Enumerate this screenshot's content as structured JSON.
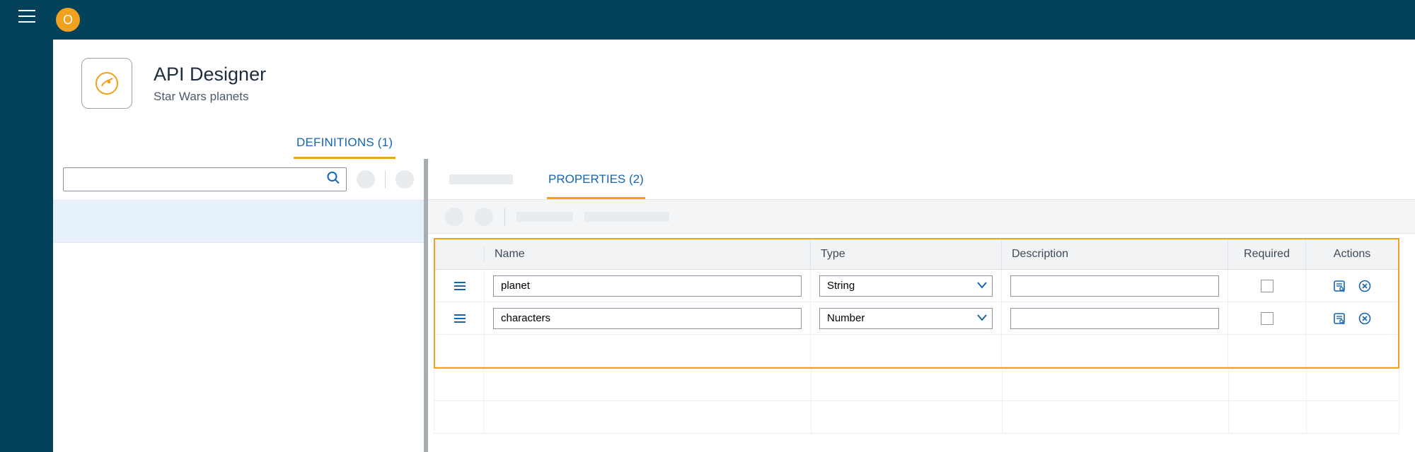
{
  "topbar": {
    "avatar_letter": "O"
  },
  "header": {
    "title": "API Designer",
    "subtitle": "Star Wars planets"
  },
  "tabs": {
    "definitions": {
      "label": "DEFINITIONS",
      "count": 1
    }
  },
  "sidebar": {
    "search_placeholder": ""
  },
  "detail_tabs": {
    "properties": {
      "label": "PROPERTIES",
      "count": 2
    }
  },
  "columns": {
    "name": "Name",
    "type": "Type",
    "description": "Description",
    "required": "Required",
    "actions": "Actions"
  },
  "rows": [
    {
      "name": "planet",
      "type": "String",
      "description": "",
      "required": false
    },
    {
      "name": "characters",
      "type": "Number",
      "description": "",
      "required": false
    }
  ]
}
